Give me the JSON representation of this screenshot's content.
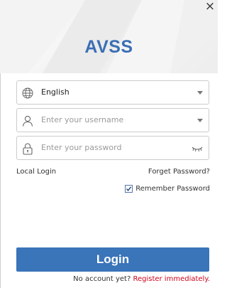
{
  "header": {
    "app_title": "AVSS",
    "close_glyph": "×"
  },
  "form": {
    "language": {
      "value": "English",
      "icon": "globe-icon"
    },
    "username": {
      "placeholder": "Enter your username",
      "icon": "user-icon"
    },
    "password": {
      "placeholder": "Enter your password",
      "icon": "lock-icon"
    }
  },
  "links": {
    "local_login": "Local Login",
    "forget_password": "Forget Password?"
  },
  "remember": {
    "label": "Remember Password",
    "checked": true
  },
  "login_button": "Login",
  "footer": {
    "prompt": "No account yet?",
    "register": "Register immediately."
  },
  "colors": {
    "brand": "#3b6fb4",
    "button": "#3a74b9",
    "register_link": "#d0021b"
  }
}
